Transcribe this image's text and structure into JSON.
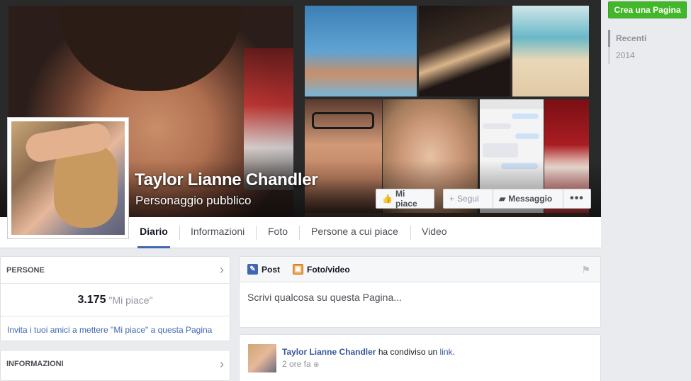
{
  "page": {
    "name": "Taylor Lianne Chandler",
    "category": "Personaggio pubblico"
  },
  "cover_buttons": {
    "like": "Mi piace",
    "follow": "Segui",
    "message": "Messaggio",
    "more": "•••"
  },
  "tabs": [
    {
      "label": "Diario"
    },
    {
      "label": "Informazioni"
    },
    {
      "label": "Foto"
    },
    {
      "label": "Persone a cui piace"
    },
    {
      "label": "Video"
    }
  ],
  "persone": {
    "title": "PERSONE",
    "likes_number": "3.175",
    "likes_label": "\"Mi piace\"",
    "invite_text": "Invita i tuoi amici a mettere \"Mi piace\" a questa Pagina"
  },
  "informazioni": {
    "title": "INFORMAZIONI"
  },
  "composer": {
    "tab_post": "Post",
    "tab_photo": "Foto/video",
    "placeholder": "Scrivi qualcosa su questa Pagina..."
  },
  "post": {
    "author": "Taylor Lianne Chandler",
    "action": "ha condiviso un",
    "link_text": "link",
    "period": ".",
    "time": "2 ore fa"
  },
  "sidebar": {
    "create_page": "Crea una Pagina",
    "timeline": [
      {
        "label": "Recenti"
      },
      {
        "label": "2014"
      }
    ]
  },
  "colors": {
    "brand_blue": "#4267b2",
    "create_green": "#42b72a",
    "background": "#e9ebee"
  }
}
